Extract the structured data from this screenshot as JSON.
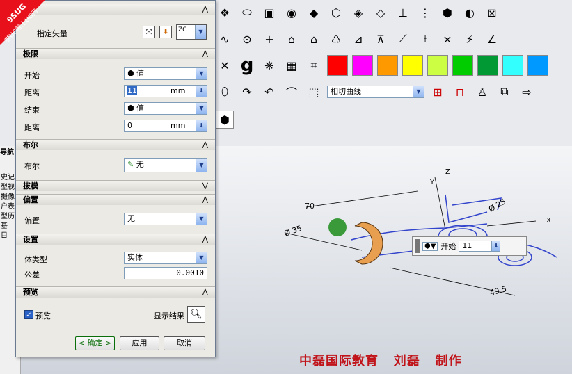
{
  "dialog": {
    "vector_label": "指定矢量",
    "vector_button_label": "ZC",
    "sections": {
      "limits": {
        "title": "极限"
      },
      "bool": {
        "title": "布尔"
      },
      "draft": {
        "title": "拔模"
      },
      "offset": {
        "title": "偏置"
      },
      "settings": {
        "title": "设置"
      },
      "preview": {
        "title": "预览"
      }
    },
    "start_label": "开始",
    "start_value": "值",
    "start_distance_label": "距离",
    "start_distance_value": "11",
    "end_label": "结束",
    "end_value": "值",
    "end_distance_label": "距离",
    "end_distance_value": "0",
    "unit": "mm",
    "bool_label": "布尔",
    "bool_value": "无",
    "offset_label": "偏置",
    "offset_value": "无",
    "body_type_label": "体类型",
    "body_type_value": "实体",
    "tolerance_label": "公差",
    "tolerance_value": "0.0010",
    "preview_checkbox_label": "预览",
    "show_result_label": "显示结果",
    "ok_label": "< 确定 >",
    "apply_label": "应用",
    "cancel_label": "取消"
  },
  "toolbar": {
    "curve_type_value": "相切曲线",
    "colors": [
      "#ff0000",
      "#ff00ff",
      "#ff9900",
      "#ffff00",
      "#ccff44",
      "#00cc00",
      "#009933",
      "#33ffff",
      "#0099ff"
    ]
  },
  "left_nav": {
    "title": "导航",
    "items": [
      "史记录",
      "型视图",
      "摄像",
      "户表达",
      "型历史",
      "基",
      "目"
    ]
  },
  "viewport": {
    "dim_70": "70",
    "dim_35": "Ø 35",
    "dim_25": "Ø 25",
    "dim_49_5": "49.5",
    "axis_x": "X",
    "axis_y": "Y",
    "axis_z": "Z",
    "tip_label": "开始",
    "tip_value": "11"
  },
  "watermark": {
    "line1": "9SUG",
    "line2": "学UG就上UG网"
  },
  "credit": "中磊国际教育   刘磊   制作"
}
